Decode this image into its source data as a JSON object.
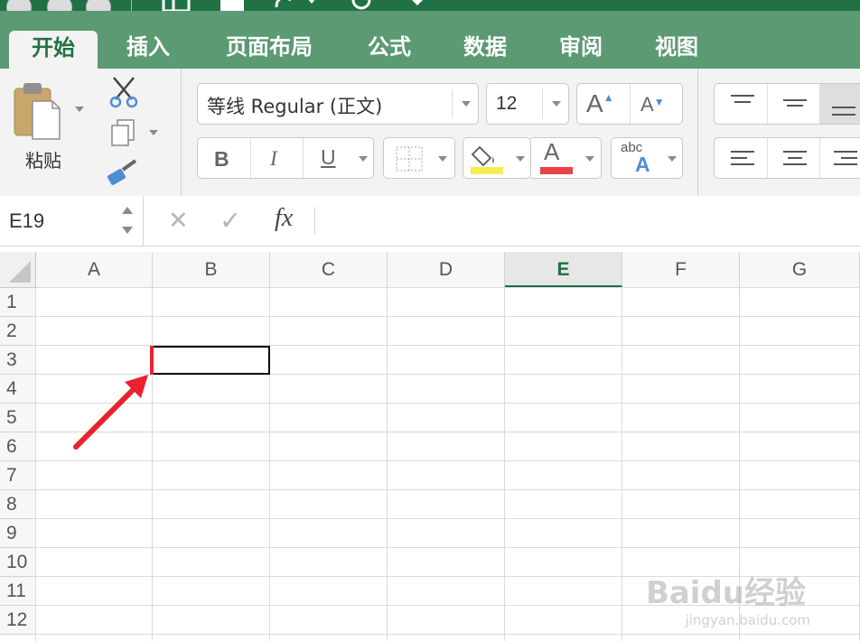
{
  "ribbon_tabs": [
    "开始",
    "插入",
    "页面布局",
    "公式",
    "数据",
    "审阅",
    "视图"
  ],
  "active_tab": "开始",
  "clipboard": {
    "paste_label": "粘贴"
  },
  "font": {
    "name": "等线 Regular (正文)",
    "size": "12",
    "bold": "B",
    "italic": "I",
    "underline": "U",
    "grow": "A",
    "shrink": "A",
    "color_glyph": "A",
    "phonetic_top": "abc",
    "phonetic_bottom": "A"
  },
  "colors": {
    "accent": "#207245",
    "fill_highlight": "#f7ec4f",
    "font_color": "#e8434a",
    "arrow": "#e8232e",
    "selection_border": "#000000"
  },
  "formula_bar": {
    "name_box": "E19",
    "cancel_glyph": "✕",
    "enter_glyph": "✓",
    "fx_label": "fx",
    "formula": ""
  },
  "columns": [
    "A",
    "B",
    "C",
    "D",
    "E",
    "F",
    "G"
  ],
  "active_column": "E",
  "rows": [
    "1",
    "2",
    "3",
    "4",
    "5",
    "6",
    "7",
    "8",
    "9",
    "10",
    "11",
    "12"
  ],
  "selected_cell": "B3",
  "watermark": {
    "brand": "Baidu经验",
    "url": "jingyan.baidu.com"
  }
}
